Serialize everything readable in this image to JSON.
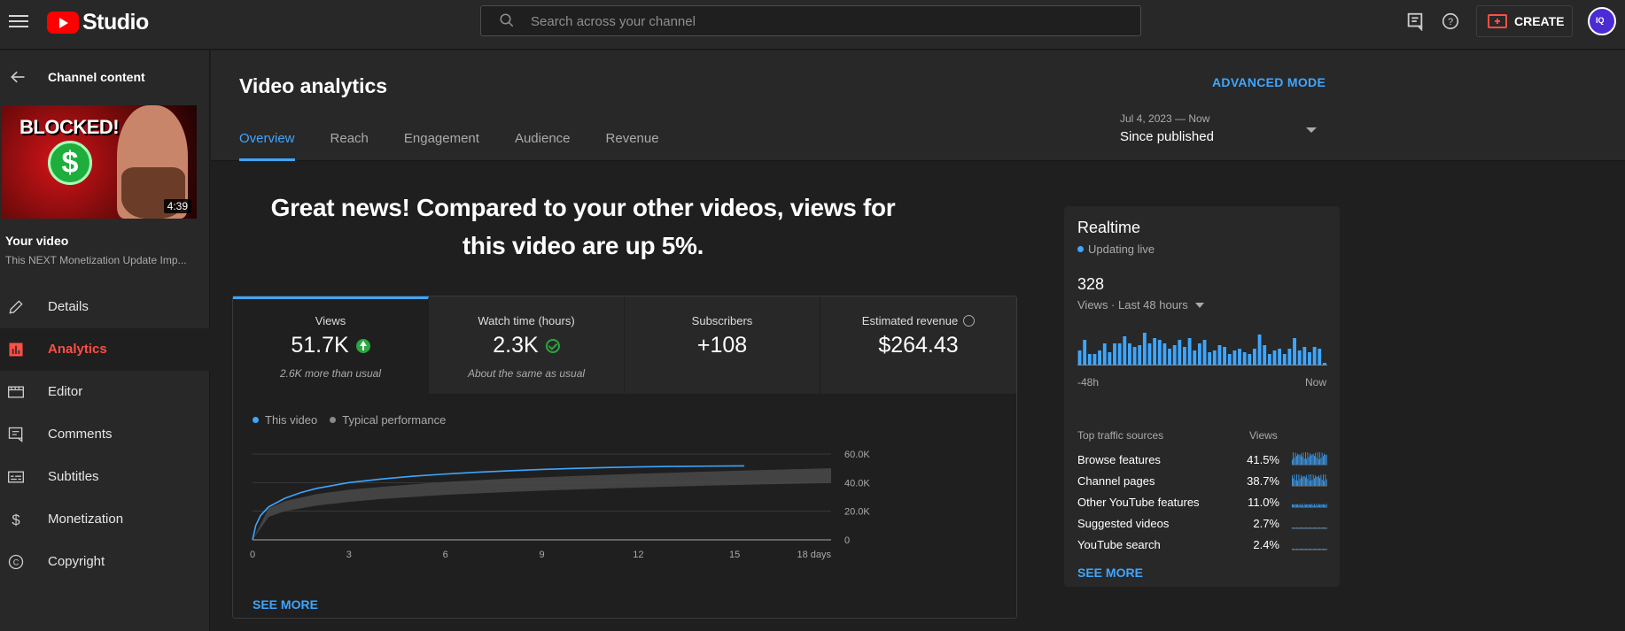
{
  "topbar": {
    "brand": "Studio",
    "search_placeholder": "Search across your channel",
    "create_label": "CREATE",
    "avatar_text": "IQ"
  },
  "sidebar": {
    "back_label": "Channel content",
    "thumbnail": {
      "overlay_text": "BLOCKED!",
      "duration": "4:39"
    },
    "your_video_label": "Your video",
    "video_title": "This NEXT Monetization Update Imp...",
    "items": [
      {
        "label": "Details",
        "icon": "pencil-icon",
        "active": false
      },
      {
        "label": "Analytics",
        "icon": "analytics-icon",
        "active": true
      },
      {
        "label": "Editor",
        "icon": "film-icon",
        "active": false
      },
      {
        "label": "Comments",
        "icon": "comment-icon",
        "active": false
      },
      {
        "label": "Subtitles",
        "icon": "subtitles-icon",
        "active": false
      },
      {
        "label": "Monetization",
        "icon": "dollar-icon",
        "active": false
      },
      {
        "label": "Copyright",
        "icon": "copyright-icon",
        "active": false
      }
    ]
  },
  "header": {
    "title": "Video analytics",
    "advanced_mode": "ADVANCED MODE",
    "tabs": [
      "Overview",
      "Reach",
      "Engagement",
      "Audience",
      "Revenue"
    ],
    "active_tab": "Overview",
    "date_range": {
      "sub": "Jul 4, 2023 — Now",
      "main": "Since published"
    }
  },
  "headline": "Great news! Compared to your other videos, views for this video are up 5%.",
  "metrics": [
    {
      "label": "Views",
      "value": "51.7K",
      "note": "2.6K more than usual",
      "badge": "up"
    },
    {
      "label": "Watch time (hours)",
      "value": "2.3K",
      "note": "About the same as usual",
      "badge": "ok"
    },
    {
      "label": "Subscribers",
      "value": "+108",
      "note": "",
      "badge": ""
    },
    {
      "label": "Estimated revenue",
      "value": "$264.43",
      "note": "",
      "badge": "clock"
    }
  ],
  "colors": {
    "accent": "#3ea6ff",
    "active_nav": "#ff4e45",
    "positive": "#2ba640"
  },
  "chart_data": {
    "type": "line",
    "legend": [
      "This video",
      "Typical performance"
    ],
    "x_ticks": [
      "0",
      "3",
      "6",
      "9",
      "12",
      "15",
      "18 days"
    ],
    "y_ticks": [
      "60.0K",
      "40.0K",
      "20.0K",
      "0"
    ],
    "ylim": [
      0,
      60000
    ],
    "xlim": [
      0,
      18
    ],
    "series": [
      {
        "name": "This video",
        "color": "#3ea6ff",
        "x": [
          0,
          0.1,
          0.25,
          0.5,
          1,
          1.5,
          2,
          3,
          4,
          5,
          6,
          7,
          8,
          9,
          10,
          11,
          12,
          13,
          14,
          15.3
        ],
        "y": [
          0,
          10000,
          17000,
          23000,
          29000,
          33000,
          36000,
          40000,
          42500,
          44500,
          46000,
          47300,
          48300,
          49200,
          49900,
          50500,
          51000,
          51300,
          51500,
          51700
        ]
      },
      {
        "name": "Typical performance",
        "color": "#8a8a8a",
        "x": [
          0,
          0.5,
          1,
          2,
          3,
          4,
          6,
          8,
          10,
          12,
          14,
          16,
          18
        ],
        "y_low": [
          0,
          16000,
          20000,
          24000,
          26500,
          28500,
          31500,
          33500,
          35200,
          36600,
          37800,
          38800,
          39700
        ],
        "y_high": [
          0,
          22000,
          27000,
          32000,
          35000,
          37000,
          40500,
          42800,
          44600,
          46200,
          47600,
          48900,
          50000
        ]
      }
    ]
  },
  "chart_see_more": "SEE MORE",
  "realtime": {
    "title": "Realtime",
    "live_label": "Updating live",
    "count": "328",
    "period": "Views · Last 48 hours",
    "axis_left": "-48h",
    "axis_right": "Now",
    "bars": [
      0.4,
      0.7,
      0.3,
      0.3,
      0.4,
      0.6,
      0.35,
      0.6,
      0.6,
      0.8,
      0.6,
      0.5,
      0.55,
      0.9,
      0.6,
      0.75,
      0.7,
      0.6,
      0.45,
      0.55,
      0.7,
      0.5,
      0.75,
      0.4,
      0.6,
      0.7,
      0.35,
      0.4,
      0.55,
      0.5,
      0.3,
      0.4,
      0.45,
      0.35,
      0.3,
      0.45,
      0.85,
      0.55,
      0.3,
      0.4,
      0.45,
      0.3,
      0.45,
      0.75,
      0.4,
      0.5,
      0.35,
      0.5,
      0.45,
      0.05
    ],
    "traffic_header": {
      "name": "Top traffic sources",
      "views": "Views"
    },
    "traffic": [
      {
        "name": "Browse features",
        "pct": "41.5%"
      },
      {
        "name": "Channel pages",
        "pct": "38.7%"
      },
      {
        "name": "Other YouTube features",
        "pct": "11.0%"
      },
      {
        "name": "Suggested videos",
        "pct": "2.7%"
      },
      {
        "name": "YouTube search",
        "pct": "2.4%"
      }
    ],
    "see_more": "SEE MORE"
  }
}
